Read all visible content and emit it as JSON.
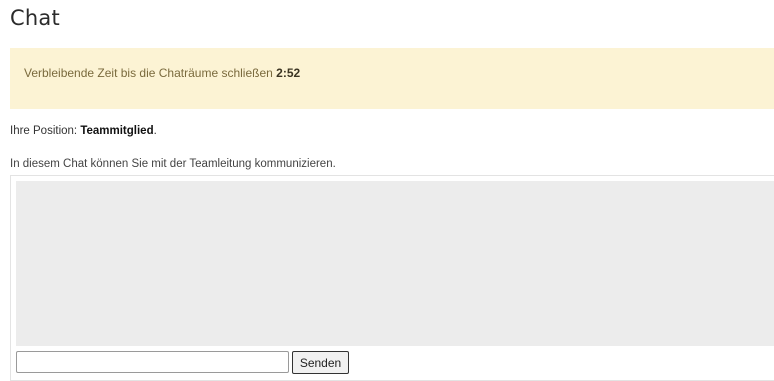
{
  "page": {
    "title": "Chat"
  },
  "timer": {
    "text": "Verbleibende Zeit bis die Chaträume schließen",
    "value": "2:52"
  },
  "position": {
    "label": "Ihre Position:",
    "role": "Teammitglied",
    "suffix": "."
  },
  "chat": {
    "intro": "In diesem Chat können Sie mit der Teamleitung kommunizieren.",
    "input_value": "",
    "input_placeholder": "",
    "send_label": "Senden"
  },
  "colors": {
    "alert_background": "#fcf3d4",
    "chat_log_background": "#ececec"
  }
}
